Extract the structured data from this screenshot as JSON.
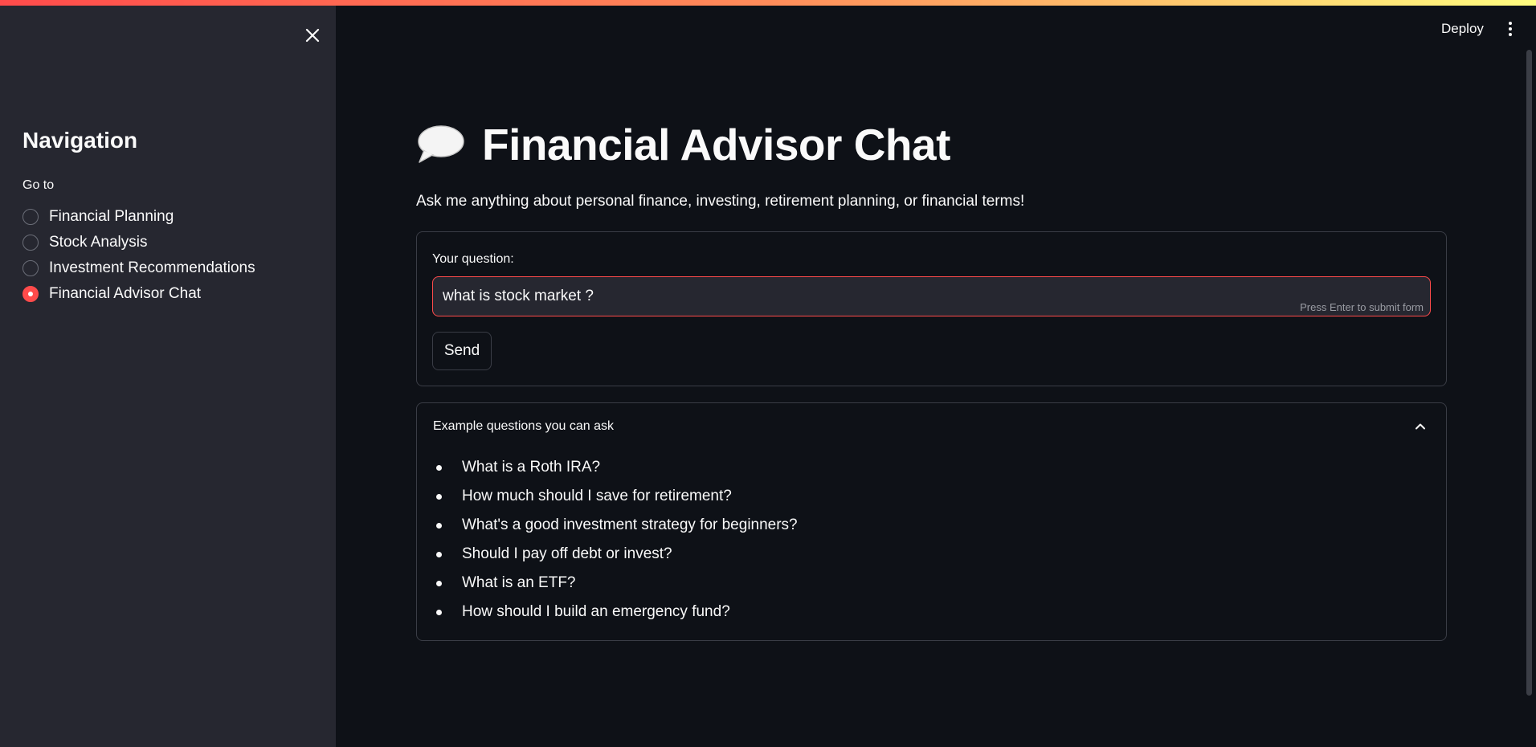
{
  "sidebar": {
    "close_icon": "close-icon",
    "nav_title": "Navigation",
    "goto_label": "Go to",
    "options": [
      {
        "label": "Financial Planning",
        "selected": false
      },
      {
        "label": "Stock Analysis",
        "selected": false
      },
      {
        "label": "Investment Recommendations",
        "selected": false
      },
      {
        "label": "Financial Advisor Chat",
        "selected": true
      }
    ]
  },
  "header": {
    "deploy_label": "Deploy",
    "menu_icon": "vertical-dots-icon"
  },
  "main": {
    "title_icon": "speech-balloon-icon",
    "title": "Financial Advisor Chat",
    "subtitle": "Ask me anything about personal finance, investing, retirement planning, or financial terms!",
    "form": {
      "question_label": "Your question:",
      "question_value": "what is stock market ?",
      "enter_hint": "Press Enter to submit form",
      "send_label": "Send"
    },
    "examples": {
      "title": "Example questions you can ask",
      "expanded": true,
      "items": [
        "What is a Roth IRA?",
        "How much should I save for retirement?",
        "What's a good investment strategy for beginners?",
        "Should I pay off debt or invest?",
        "What is an ETF?",
        "How should I build an emergency fund?"
      ]
    }
  },
  "colors": {
    "accent": "#ff4b4b",
    "background": "#0e1117",
    "sidebar_bg": "#262730",
    "text": "#fafafa",
    "border": "#3a3d46"
  }
}
